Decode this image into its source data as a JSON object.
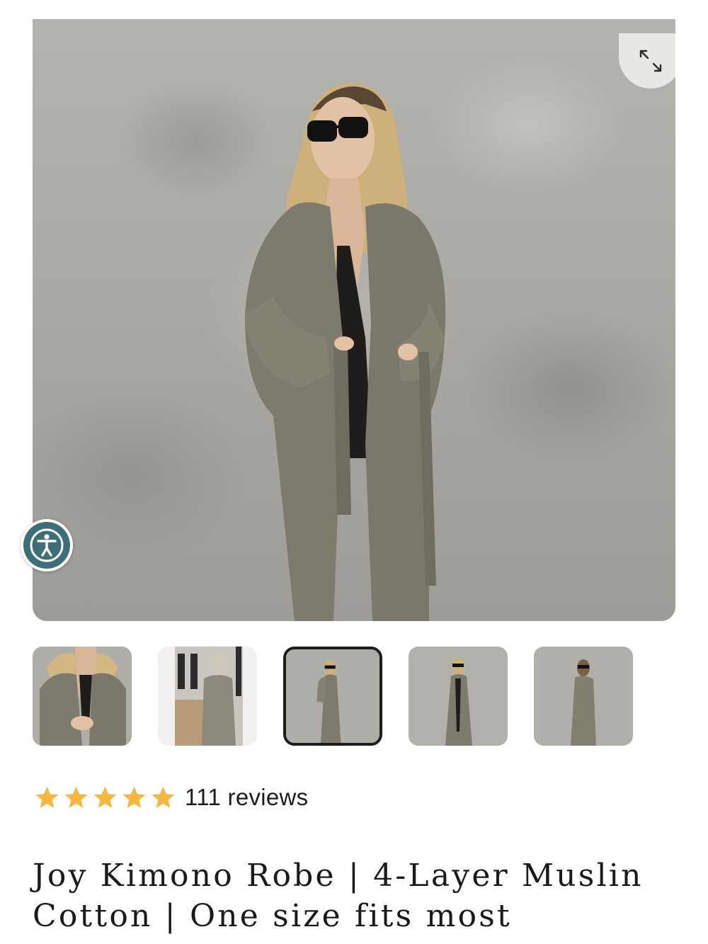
{
  "product": {
    "title": "Joy Kimono Robe | 4-Layer Muslin Cotton | One size fits most",
    "rating": {
      "stars": 5,
      "reviews_label": "111 reviews"
    }
  },
  "gallery": {
    "selected_index": 2,
    "thumbnail_count": 5
  },
  "icons": {
    "expand": "expand-arrows-icon",
    "accessibility": "accessibility-person-icon",
    "star": "star-icon"
  },
  "colors": {
    "star": "#f4b740",
    "accessibility_badge": "#3c6f77",
    "selected_thumb_border": "#1c1c1c",
    "expand_button_bg": "#e8e7e4"
  }
}
